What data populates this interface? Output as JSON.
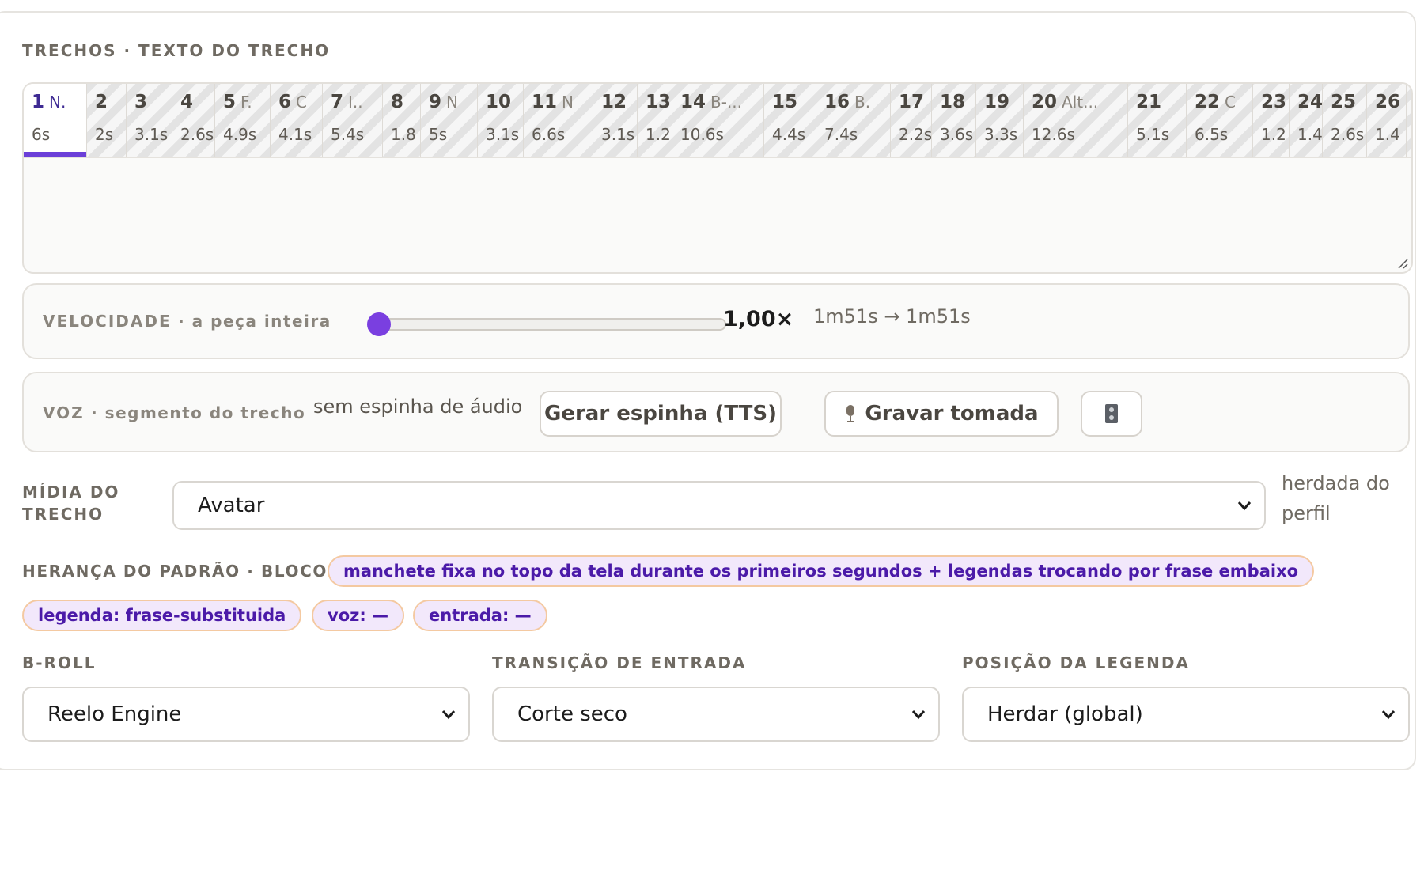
{
  "segments": {
    "section_label": "TRECHOS · TEXTO DO TRECHO",
    "tabs": [
      {
        "num": "1",
        "label": "N.",
        "dur": "6s",
        "active": true
      },
      {
        "num": "2",
        "label": "",
        "dur": "2s"
      },
      {
        "num": "3",
        "label": "",
        "dur": "3.1s"
      },
      {
        "num": "4",
        "label": "",
        "dur": "2.6s"
      },
      {
        "num": "5",
        "label": "F.",
        "dur": "4.9s"
      },
      {
        "num": "6",
        "label": "C",
        "dur": "4.1s"
      },
      {
        "num": "7",
        "label": "I..",
        "dur": "5.4s"
      },
      {
        "num": "8",
        "label": "",
        "dur": "1.8"
      },
      {
        "num": "9",
        "label": "N",
        "dur": "5s"
      },
      {
        "num": "10",
        "label": "",
        "dur": "3.1s"
      },
      {
        "num": "11",
        "label": "N",
        "dur": "6.6s"
      },
      {
        "num": "12",
        "label": "",
        "dur": "3.1s"
      },
      {
        "num": "13",
        "label": "",
        "dur": "1.2"
      },
      {
        "num": "14",
        "label": "B-...",
        "dur": "10.6s"
      },
      {
        "num": "15",
        "label": "",
        "dur": "4.4s"
      },
      {
        "num": "16",
        "label": "B.",
        "dur": "7.4s"
      },
      {
        "num": "17",
        "label": "",
        "dur": "2.2s"
      },
      {
        "num": "18",
        "label": "",
        "dur": "3.6s"
      },
      {
        "num": "19",
        "label": "",
        "dur": "3.3s"
      },
      {
        "num": "20",
        "label": "Alt...",
        "dur": "12.6s"
      },
      {
        "num": "21",
        "label": "",
        "dur": "5.1s"
      },
      {
        "num": "22",
        "label": "C",
        "dur": "6.5s"
      },
      {
        "num": "23",
        "label": "",
        "dur": "1.2"
      },
      {
        "num": "24",
        "label": "",
        "dur": "1.4"
      },
      {
        "num": "25",
        "label": "",
        "dur": "2.6s"
      },
      {
        "num": "26",
        "label": "",
        "dur": "1.4"
      }
    ],
    "text_value": ""
  },
  "speed": {
    "label_caps": "VELOCIDADE",
    "label_rest": " · a peça inteira",
    "value": "1,00×",
    "slider_fraction": 0.0,
    "duration_change": "1m51s → 1m51s"
  },
  "voice": {
    "label_caps": "VOZ",
    "label_rest": " · segmento do trecho",
    "status": "sem espinha de áudio",
    "generate_button": "Gerar espinha (TTS)",
    "record_button": "Gravar tomada",
    "record_icon": "microphone-icon",
    "extra_icon": "mixer-icon"
  },
  "media": {
    "label_line1": "MÍDIA DO",
    "label_line2": "TRECHO",
    "selected": "Avatar",
    "note_line1": "herdada do",
    "note_line2": "perfil"
  },
  "inheritance": {
    "label": "HERANÇA DO PADRÃO · BLOCO 1",
    "chips": [
      "manchete fixa no topo da tela durante os primeiros segundos + legendas trocando por frase embaixo",
      "legenda: frase-substituida",
      "voz: —",
      "entrada: —"
    ]
  },
  "broll": {
    "label": "B-ROLL",
    "selected": "Reelo Engine"
  },
  "transition": {
    "label": "TRANSIÇÃO DE ENTRADA",
    "selected": "Corte seco"
  },
  "caption_position": {
    "label": "POSIÇÃO DA LEGENDA",
    "selected": "Herdar (global)"
  },
  "colors": {
    "accent": "#7a3fe0",
    "chip_bg": "#f2e8fb",
    "chip_border": "#f4c9a1",
    "chip_text": "#4b1aa8"
  }
}
